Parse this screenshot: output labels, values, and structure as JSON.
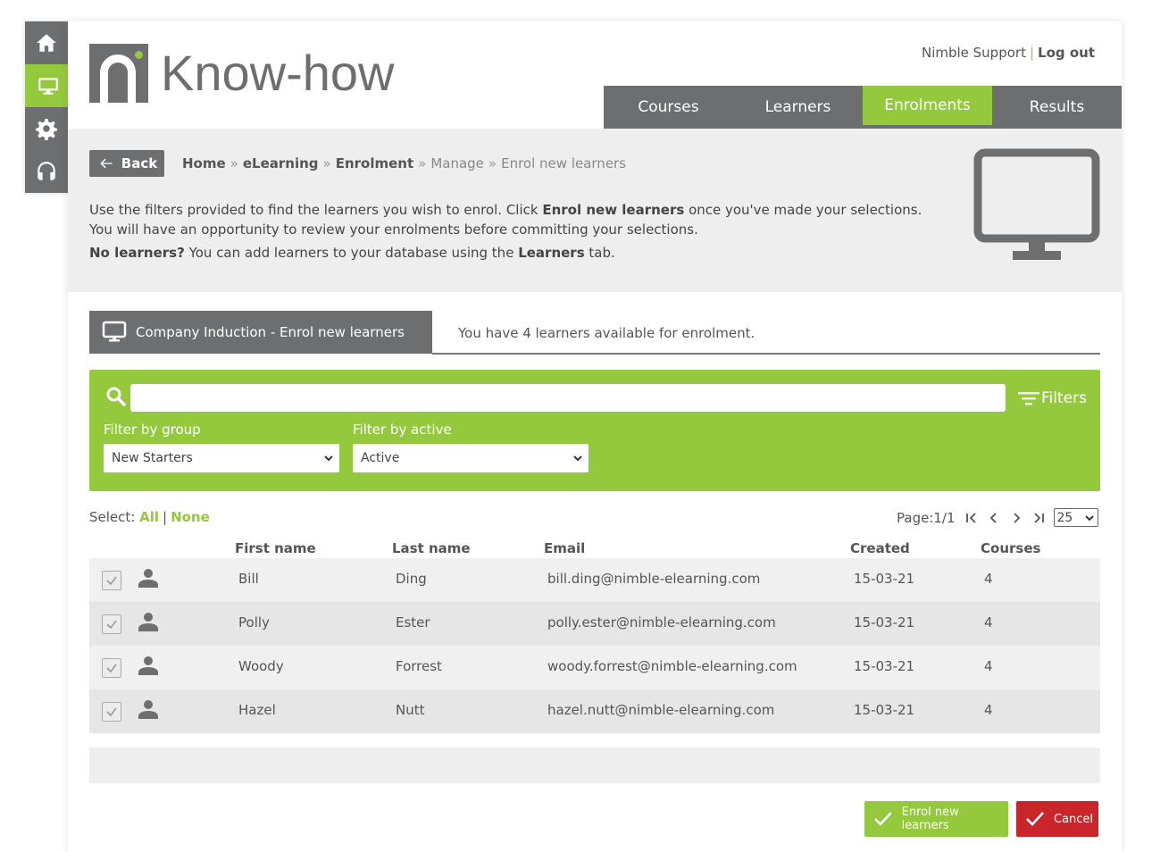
{
  "colors": {
    "accent": "#94c83d",
    "dark": "#6d6e70",
    "danger": "#c8262b",
    "band": "#eeeeee"
  },
  "rail": [
    {
      "icon": "home-icon"
    },
    {
      "icon": "monitor-icon",
      "active": true
    },
    {
      "icon": "gear-icon"
    },
    {
      "icon": "headset-icon"
    }
  ],
  "brand": {
    "name": "Know-how"
  },
  "toplinks": {
    "support": "Nimble Support",
    "separator": "|",
    "logout": "Log out"
  },
  "nav": {
    "tabs": [
      "Courses",
      "Learners",
      "Enrolments",
      "Results"
    ],
    "active": "Enrolments"
  },
  "back_label": "Back",
  "breadcrumb": {
    "home": "Home",
    "sep": "»",
    "elearning": "eLearning",
    "enrolment": "Enrolment",
    "manage": "Manage",
    "current": "Enrol new learners"
  },
  "intro": {
    "part1": "Use the filters provided to find the learners you wish to enrol. Click ",
    "bold1": "Enrol new learners",
    "part2": " once you've made your selections.",
    "line2": "You will have an opportunity to review your enrolments before committing your selections.",
    "no_learners_bold": "No learners?",
    "no_learners_text": " You can add learners to your database using the ",
    "learners_bold": "Learners",
    "tab_text": " tab."
  },
  "course_tab": {
    "label": "Company Induction - Enrol new learners"
  },
  "available_text": "You have 4 learners available for enrolment.",
  "filters": {
    "search_value": "",
    "filters_label": "Filters",
    "group_label": "Filter by group",
    "group_value": "New Starters",
    "active_label": "Filter by active",
    "active_value": "Active"
  },
  "select": {
    "label": "Select:",
    "all": "All",
    "separator": "|",
    "none": "None"
  },
  "pager": {
    "label": "Page:1/1",
    "per_page": "25"
  },
  "table": {
    "headers": {
      "first": "First name",
      "last": "Last name",
      "email": "Email",
      "created": "Created",
      "courses": "Courses"
    },
    "rows": [
      {
        "first": "Bill",
        "last": "Ding",
        "email": "bill.ding@nimble-elearning.com",
        "created": "15-03-21",
        "courses": "4"
      },
      {
        "first": "Polly",
        "last": "Ester",
        "email": "polly.ester@nimble-elearning.com",
        "created": "15-03-21",
        "courses": "4"
      },
      {
        "first": "Woody",
        "last": "Forrest",
        "email": "woody.forrest@nimble-elearning.com",
        "created": "15-03-21",
        "courses": "4"
      },
      {
        "first": "Hazel",
        "last": "Nutt",
        "email": "hazel.nutt@nimble-elearning.com",
        "created": "15-03-21",
        "courses": "4"
      }
    ]
  },
  "actions": {
    "enrol": "Enrol new learners",
    "cancel": "Cancel"
  }
}
